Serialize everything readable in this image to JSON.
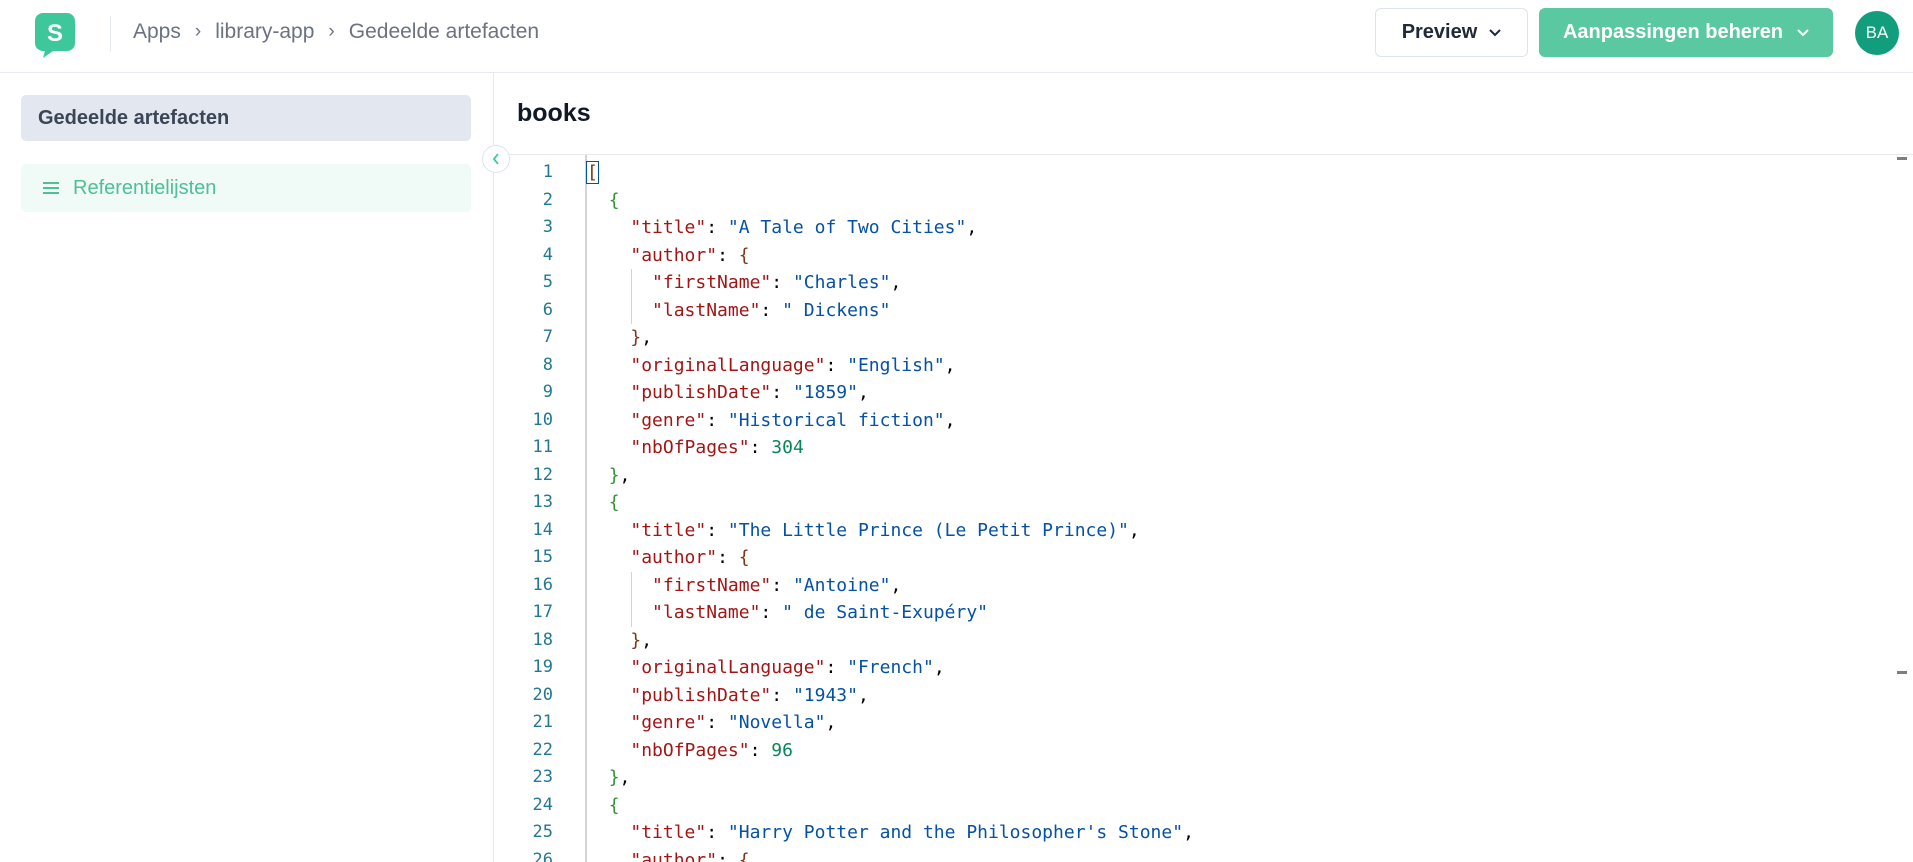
{
  "header": {
    "breadcrumb": [
      "Apps",
      "library-app",
      "Gedeelde artefacten"
    ],
    "preview_label": "Preview",
    "manage_label": "Aanpassingen beheren",
    "avatar_initials": "BA",
    "logo_letter": "S"
  },
  "sidebar": {
    "section_title": "Gedeelde artefacten",
    "items": [
      {
        "label": "Referentielijsten",
        "icon": "menu-icon"
      }
    ]
  },
  "main": {
    "title": "books"
  },
  "colors": {
    "accent": "#5ac8a0",
    "avatar": "#129e7c",
    "key": "#a31515",
    "string": "#0451a5",
    "number": "#098658",
    "line_number": "#237893"
  },
  "editor": {
    "line_numbers": [
      "1",
      "2",
      "3",
      "4",
      "5",
      "6",
      "7",
      "8",
      "9",
      "10",
      "11",
      "12",
      "13",
      "14",
      "15",
      "16",
      "17",
      "18",
      "19",
      "20",
      "21",
      "22",
      "23",
      "24",
      "25",
      "26"
    ],
    "lines": [
      [
        {
          "t": "[",
          "c": "b2 cursor-box"
        }
      ],
      [
        {
          "t": "  "
        },
        {
          "t": "{",
          "c": "b"
        }
      ],
      [
        {
          "t": "    "
        },
        {
          "t": "\"title\"",
          "c": "k"
        },
        {
          "t": ": "
        },
        {
          "t": "\"A Tale of Two Cities\"",
          "c": "s"
        },
        {
          "t": ","
        }
      ],
      [
        {
          "t": "    "
        },
        {
          "t": "\"author\"",
          "c": "k"
        },
        {
          "t": ": "
        },
        {
          "t": "{",
          "c": "b2"
        }
      ],
      [
        {
          "t": "      "
        },
        {
          "t": "\"firstName\"",
          "c": "k"
        },
        {
          "t": ": "
        },
        {
          "t": "\"Charles\"",
          "c": "s"
        },
        {
          "t": ","
        }
      ],
      [
        {
          "t": "      "
        },
        {
          "t": "\"lastName\"",
          "c": "k"
        },
        {
          "t": ": "
        },
        {
          "t": "\" Dickens\"",
          "c": "s"
        }
      ],
      [
        {
          "t": "    "
        },
        {
          "t": "}",
          "c": "b2"
        },
        {
          "t": ","
        }
      ],
      [
        {
          "t": "    "
        },
        {
          "t": "\"originalLanguage\"",
          "c": "k"
        },
        {
          "t": ": "
        },
        {
          "t": "\"English\"",
          "c": "s"
        },
        {
          "t": ","
        }
      ],
      [
        {
          "t": "    "
        },
        {
          "t": "\"publishDate\"",
          "c": "k"
        },
        {
          "t": ": "
        },
        {
          "t": "\"1859\"",
          "c": "s"
        },
        {
          "t": ","
        }
      ],
      [
        {
          "t": "    "
        },
        {
          "t": "\"genre\"",
          "c": "k"
        },
        {
          "t": ": "
        },
        {
          "t": "\"Historical fiction\"",
          "c": "s"
        },
        {
          "t": ","
        }
      ],
      [
        {
          "t": "    "
        },
        {
          "t": "\"nbOfPages\"",
          "c": "k"
        },
        {
          "t": ": "
        },
        {
          "t": "304",
          "c": "n"
        }
      ],
      [
        {
          "t": "  "
        },
        {
          "t": "}",
          "c": "b"
        },
        {
          "t": ","
        }
      ],
      [
        {
          "t": "  "
        },
        {
          "t": "{",
          "c": "b"
        }
      ],
      [
        {
          "t": "    "
        },
        {
          "t": "\"title\"",
          "c": "k"
        },
        {
          "t": ": "
        },
        {
          "t": "\"The Little Prince (Le Petit Prince)\"",
          "c": "s"
        },
        {
          "t": ","
        }
      ],
      [
        {
          "t": "    "
        },
        {
          "t": "\"author\"",
          "c": "k"
        },
        {
          "t": ": "
        },
        {
          "t": "{",
          "c": "b2"
        }
      ],
      [
        {
          "t": "      "
        },
        {
          "t": "\"firstName\"",
          "c": "k"
        },
        {
          "t": ": "
        },
        {
          "t": "\"Antoine\"",
          "c": "s"
        },
        {
          "t": ","
        }
      ],
      [
        {
          "t": "      "
        },
        {
          "t": "\"lastName\"",
          "c": "k"
        },
        {
          "t": ": "
        },
        {
          "t": "\" de Saint-Exupéry\"",
          "c": "s"
        }
      ],
      [
        {
          "t": "    "
        },
        {
          "t": "}",
          "c": "b2"
        },
        {
          "t": ","
        }
      ],
      [
        {
          "t": "    "
        },
        {
          "t": "\"originalLanguage\"",
          "c": "k"
        },
        {
          "t": ": "
        },
        {
          "t": "\"French\"",
          "c": "s"
        },
        {
          "t": ","
        }
      ],
      [
        {
          "t": "    "
        },
        {
          "t": "\"publishDate\"",
          "c": "k"
        },
        {
          "t": ": "
        },
        {
          "t": "\"1943\"",
          "c": "s"
        },
        {
          "t": ","
        }
      ],
      [
        {
          "t": "    "
        },
        {
          "t": "\"genre\"",
          "c": "k"
        },
        {
          "t": ": "
        },
        {
          "t": "\"Novella\"",
          "c": "s"
        },
        {
          "t": ","
        }
      ],
      [
        {
          "t": "    "
        },
        {
          "t": "\"nbOfPages\"",
          "c": "k"
        },
        {
          "t": ": "
        },
        {
          "t": "96",
          "c": "n"
        }
      ],
      [
        {
          "t": "  "
        },
        {
          "t": "}",
          "c": "b"
        },
        {
          "t": ","
        }
      ],
      [
        {
          "t": "  "
        },
        {
          "t": "{",
          "c": "b"
        }
      ],
      [
        {
          "t": "    "
        },
        {
          "t": "\"title\"",
          "c": "k"
        },
        {
          "t": ": "
        },
        {
          "t": "\"Harry Potter and the Philosopher's Stone\"",
          "c": "s"
        },
        {
          "t": ","
        }
      ],
      [
        {
          "t": "    "
        },
        {
          "t": "\"author\"",
          "c": "k"
        },
        {
          "t": ": "
        },
        {
          "t": "{",
          "c": "b2"
        }
      ]
    ]
  }
}
